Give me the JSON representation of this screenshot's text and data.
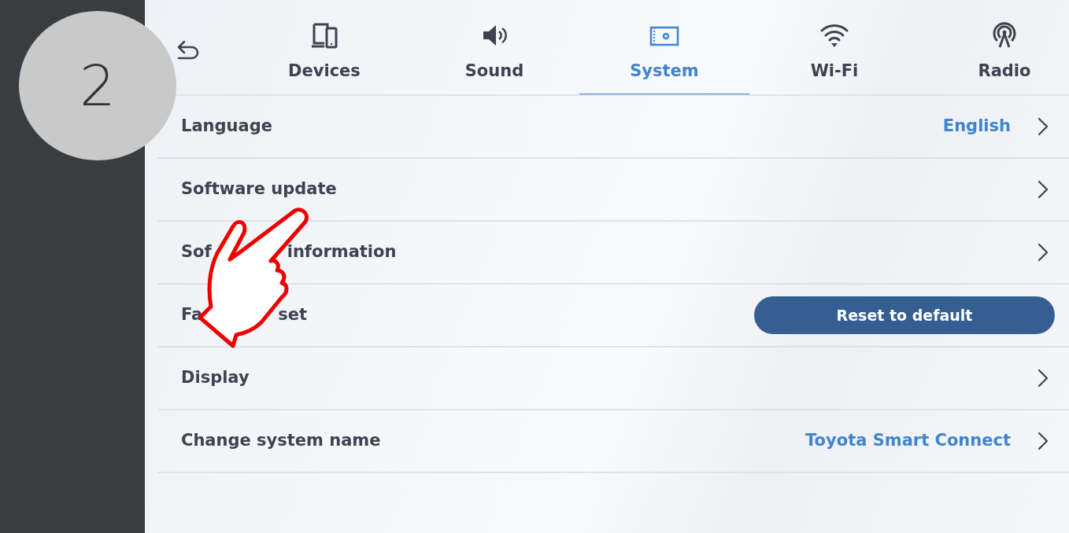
{
  "step_badge": "2",
  "tabs": [
    {
      "label": "Devices",
      "selected": false
    },
    {
      "label": "Sound",
      "selected": false
    },
    {
      "label": "System",
      "selected": true
    },
    {
      "label": "Wi-Fi",
      "selected": false
    },
    {
      "label": "Radio",
      "selected": false
    }
  ],
  "rows": [
    {
      "kind": "link",
      "label_parts": [
        "Language"
      ],
      "value": "English"
    },
    {
      "kind": "link",
      "label_parts": [
        "Software update"
      ]
    },
    {
      "kind": "link",
      "label_parts": [
        "Sof",
        "information"
      ]
    },
    {
      "kind": "button",
      "label_parts": [
        "Fa",
        "set"
      ],
      "button": "Reset to default"
    },
    {
      "kind": "link",
      "label_parts": [
        "Display"
      ]
    },
    {
      "kind": "link",
      "label_parts": [
        "Change system name"
      ],
      "value": "Toyota Smart Connect"
    }
  ]
}
